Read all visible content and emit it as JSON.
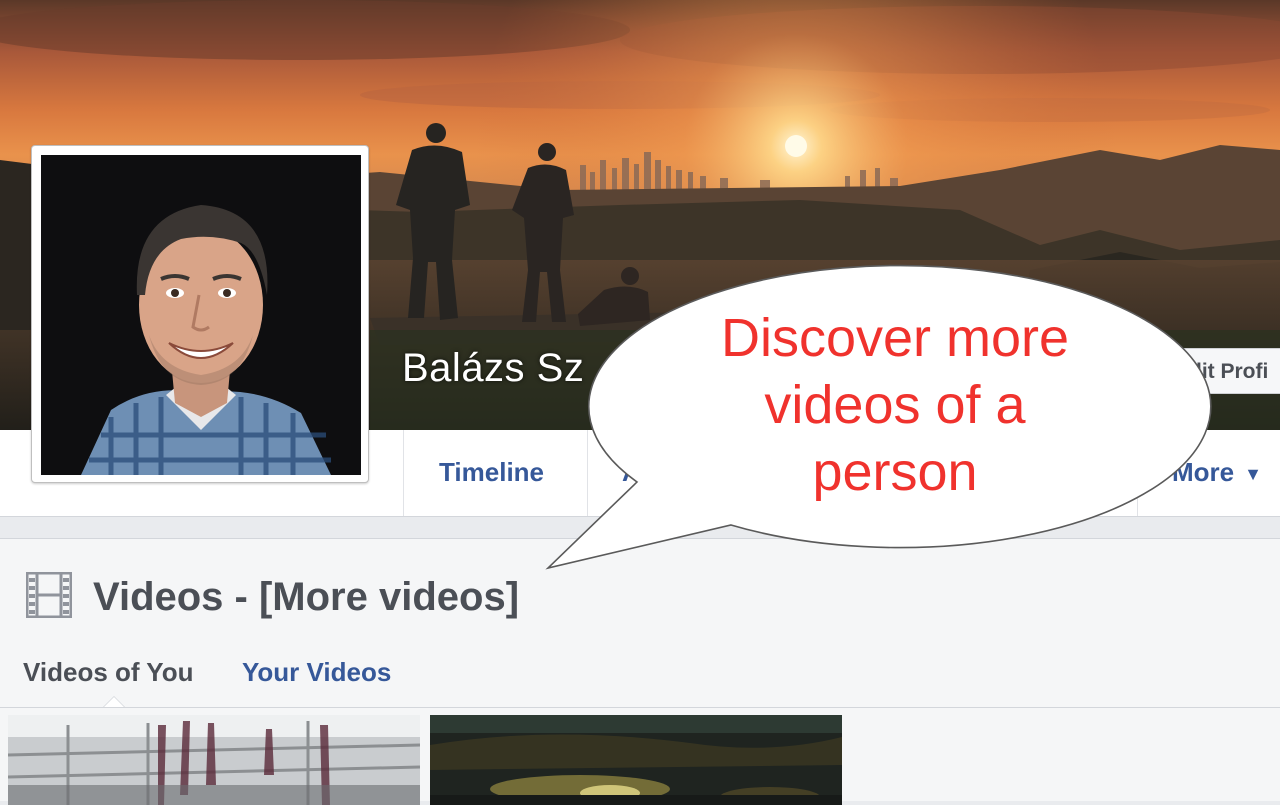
{
  "profile": {
    "name": "Balázs Sz",
    "edit_profile_label": "dit Profi"
  },
  "nav": {
    "timeline": "Timeline",
    "partial_tab": "A",
    "more": "More",
    "more_caret": "▼"
  },
  "videos": {
    "title": "Videos - [More videos]",
    "tabs": [
      "Videos of You",
      "Your Videos"
    ]
  },
  "bubble": {
    "lines": [
      "Discover more",
      "videos of a",
      "person"
    ]
  },
  "colors": {
    "link": "#365899",
    "bubble_text": "#f0322d",
    "heading": "#4b4f56"
  }
}
